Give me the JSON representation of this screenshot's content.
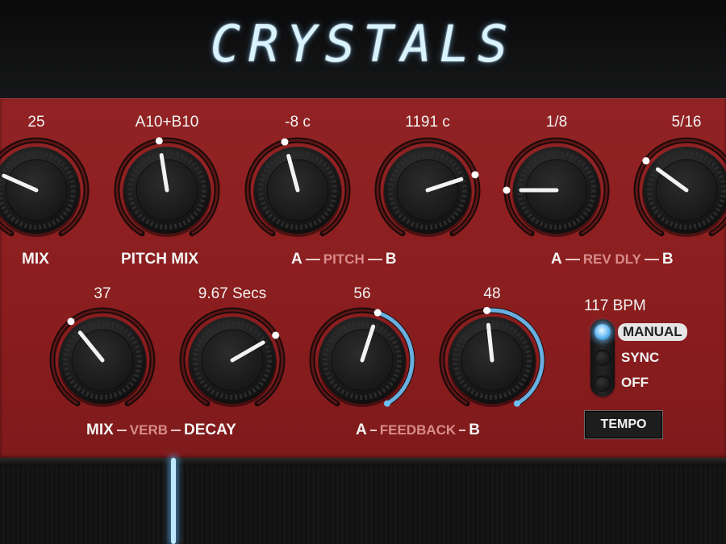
{
  "title": "CRYSTALS",
  "row1": {
    "knobs": [
      {
        "id": "mix",
        "value": "25",
        "level": 0.28
      },
      {
        "id": "pitch-mix",
        "value": "A10+B10",
        "level": 0.47
      },
      {
        "id": "pitch-a",
        "value": "-8 c",
        "level": 0.45
      },
      {
        "id": "pitch-b",
        "value": "1191 c",
        "level": 0.74
      },
      {
        "id": "rev-dly-a",
        "value": "1/8",
        "level": 0.2
      },
      {
        "id": "rev-dly-b",
        "value": "5/16",
        "level": 0.32
      }
    ],
    "labels": {
      "mix": "MIX",
      "pitch_mix": "PITCH MIX",
      "pitch_a": "A",
      "pitch_mid": "PITCH",
      "pitch_b": "B",
      "rev_a": "A",
      "rev_mid": "REV DLY",
      "rev_b": "B"
    }
  },
  "row2": {
    "knobs": [
      {
        "id": "verb-mix",
        "value": "37",
        "level": 0.37
      },
      {
        "id": "verb-decay",
        "value": "9.67 Secs",
        "level": 0.7
      },
      {
        "id": "feedback-a",
        "value": "56",
        "level": 0.56
      },
      {
        "id": "feedback-b",
        "value": "48",
        "level": 0.48
      }
    ],
    "labels": {
      "verb_mix": "MIX",
      "verb_mid": "VERB",
      "verb_decay": "DECAY",
      "fb_a": "A",
      "fb_mid": "FEEDBACK",
      "fb_b": "B"
    }
  },
  "tempo": {
    "bpm": "117 BPM",
    "options": [
      "MANUAL",
      "SYNC",
      "OFF"
    ],
    "selected": "MANUAL",
    "button": "TEMPO"
  },
  "colors": {
    "panel": "#8e1f20",
    "accent": "#6cc0f5",
    "logo": "#d9f3ff"
  }
}
